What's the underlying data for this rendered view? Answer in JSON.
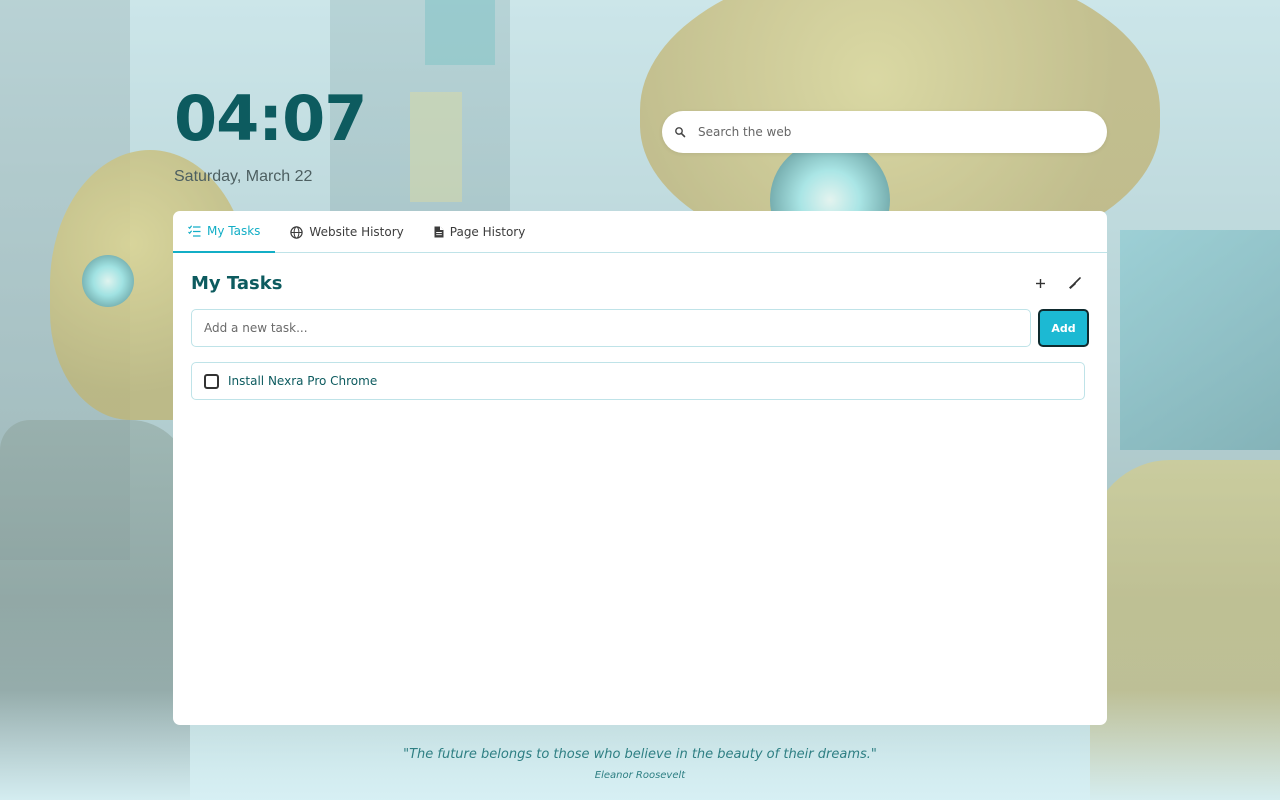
{
  "clock": {
    "time": "04:07",
    "date": "Saturday, March 22"
  },
  "search": {
    "placeholder": "Search the web"
  },
  "tabs": [
    {
      "label": "My Tasks",
      "icon": "task-list-icon",
      "active": true
    },
    {
      "label": "Website History",
      "icon": "globe-icon",
      "active": false
    },
    {
      "label": "Page History",
      "icon": "document-icon",
      "active": false
    }
  ],
  "tasks_section": {
    "title": "My Tasks",
    "new_task_placeholder": "Add a new task...",
    "add_label": "Add",
    "items": [
      {
        "text": "Install Nexra Pro Chrome",
        "done": false
      }
    ]
  },
  "quote": {
    "text": "\"The future belongs to those who believe in the beauty of their dreams.\"",
    "author": "Eleanor Roosevelt"
  },
  "colors": {
    "accent": "#13aec6",
    "heading": "#0d5b5f",
    "add_button": "#1cb9d3"
  }
}
